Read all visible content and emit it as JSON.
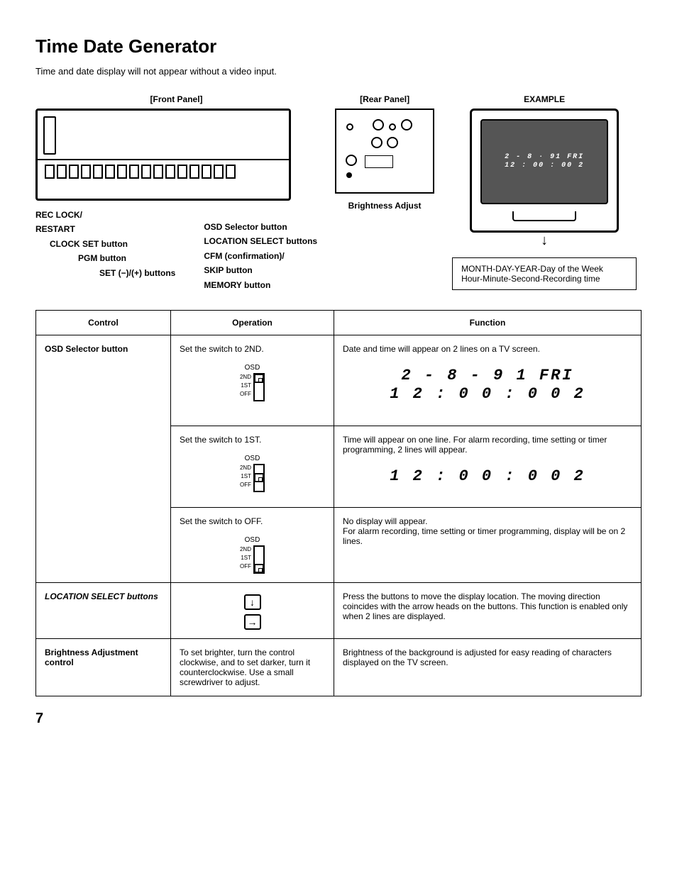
{
  "title": "Time Date Generator",
  "subtitle": "Time and date display will not appear without a video input.",
  "diagram": {
    "front_label": "[Front Panel]",
    "rear_label": "[Rear Panel]",
    "example_label": "EXAMPLE",
    "brightness_caption": "Brightness Adjust",
    "tv_line1": "2 - 8 · 91  FRI",
    "tv_line2": "12 : 00 : 00   2",
    "legend_line1": "MONTH-DAY-YEAR-Day of the Week",
    "legend_line2": "Hour-Minute-Second-Recording time",
    "callouts": {
      "rec_lock": "REC LOCK/",
      "restart": "RESTART",
      "clock_set": "CLOCK SET button",
      "pgm": "PGM button",
      "set": "SET (−)/(+) buttons",
      "osd_selector": "OSD Selector button",
      "location_select": "LOCATION SELECT buttons",
      "cfm": "CFM (confirmation)/",
      "skip": "SKIP button",
      "memory": "MEMORY button"
    }
  },
  "table": {
    "headers": {
      "control": "Control",
      "operation": "Operation",
      "function": "Function"
    },
    "rows": [
      {
        "control": "OSD Selector button",
        "operation": "Set the switch to 2ND.",
        "osd_label": "OSD",
        "ticks": [
          "2ND",
          "1ST",
          "OFF"
        ],
        "nub": "pos-2nd",
        "function_text": "Date and time will appear on 2 lines on a TV screen.",
        "seg1": "2 -  8 - 9 1   FRI",
        "seg2": "1 2 : 0 0 : 0 0     2"
      },
      {
        "control": "",
        "operation": "Set the switch to 1ST.",
        "osd_label": "OSD",
        "ticks": [
          "2ND",
          "1ST",
          "OFF"
        ],
        "nub": "pos-1st",
        "function_text": "Time will appear on one line. For alarm recording, time setting or timer programming, 2 lines will appear.",
        "seg1": "1 2 : 0 0 : 0 0     2",
        "seg2": ""
      },
      {
        "control": "",
        "operation": "Set the switch to OFF.",
        "osd_label": "OSD",
        "ticks": [
          "2ND",
          "1ST",
          "OFF"
        ],
        "nub": "pos-off",
        "function_text": "No display will appear.\nFor alarm recording, time setting or timer programming, display will be on 2 lines.",
        "seg1": "",
        "seg2": ""
      },
      {
        "control": "LOCATION SELECT buttons",
        "operation_arrows": [
          "↓",
          "→"
        ],
        "function_text": "Press the buttons to move the display location. The moving direction coincides with the arrow heads on the buttons. This function is enabled only when 2 lines are displayed."
      },
      {
        "control": "Brightness Adjustment control",
        "operation_plain": "To set brighter, turn the control clockwise, and to set darker, turn it counterclockwise. Use a small screwdriver to adjust.",
        "function_text": "Brightness of the background is adjusted for easy reading of characters displayed on the TV screen."
      }
    ]
  },
  "page_number": "7"
}
